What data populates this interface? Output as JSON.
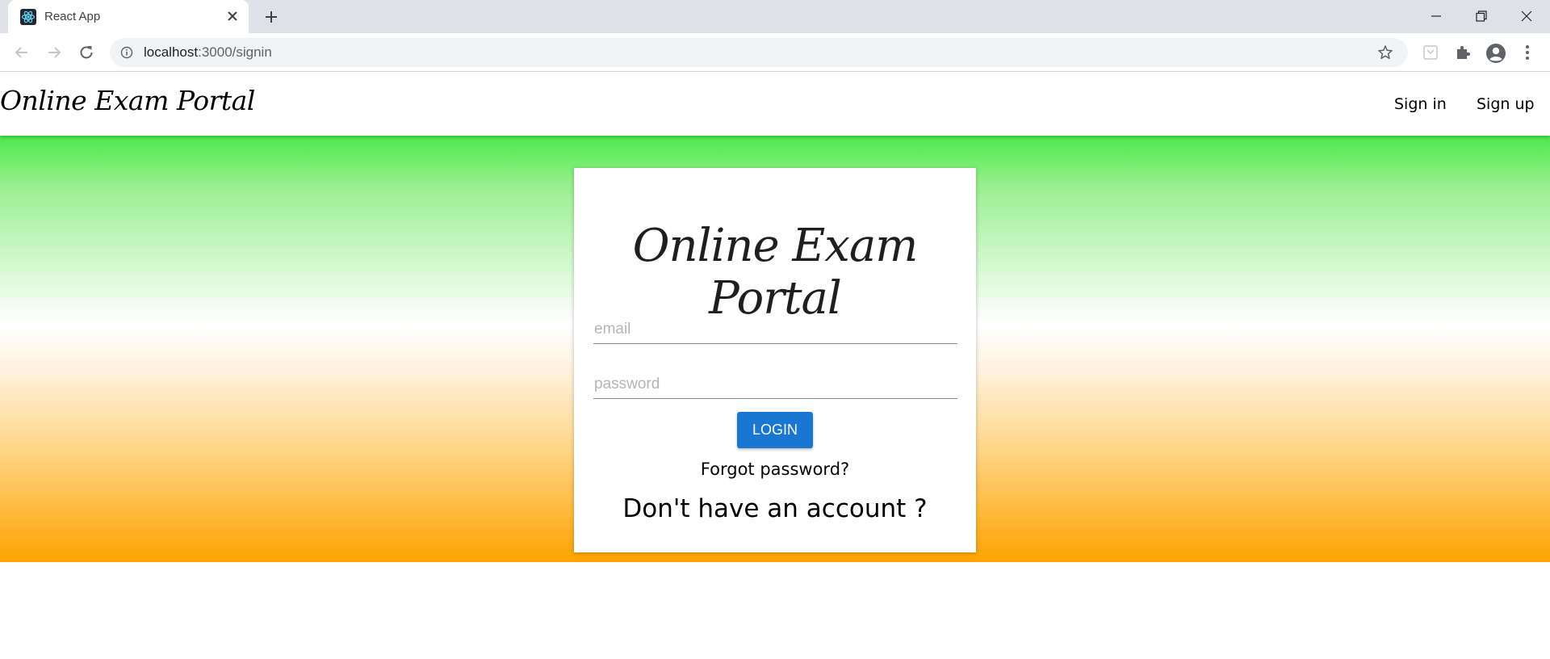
{
  "browser": {
    "tab_title": "React App",
    "url_host": "localhost",
    "url_path": ":3000/signin"
  },
  "header": {
    "brand": "Online Exam Portal",
    "nav": {
      "signin": "Sign in",
      "signup": "Sign up"
    }
  },
  "login_card": {
    "title": "Online Exam Portal",
    "email_placeholder": "email",
    "password_placeholder": "password",
    "login_label": "LOGIN",
    "forgot_link": "Forgot password?",
    "signup_prompt": "Don't have an account ?"
  },
  "colors": {
    "gradient_top": "#4ce94a",
    "gradient_bottom": "#ffa300",
    "login_button": "#1976d2"
  },
  "icons": [
    "react-favicon-icon",
    "close-icon",
    "plus-icon",
    "minimize-icon",
    "restore-icon",
    "back-arrow-icon",
    "forward-arrow-icon",
    "reload-icon",
    "info-icon",
    "star-icon",
    "extension-icon",
    "puzzle-icon",
    "profile-icon",
    "more-vert-icon"
  ]
}
